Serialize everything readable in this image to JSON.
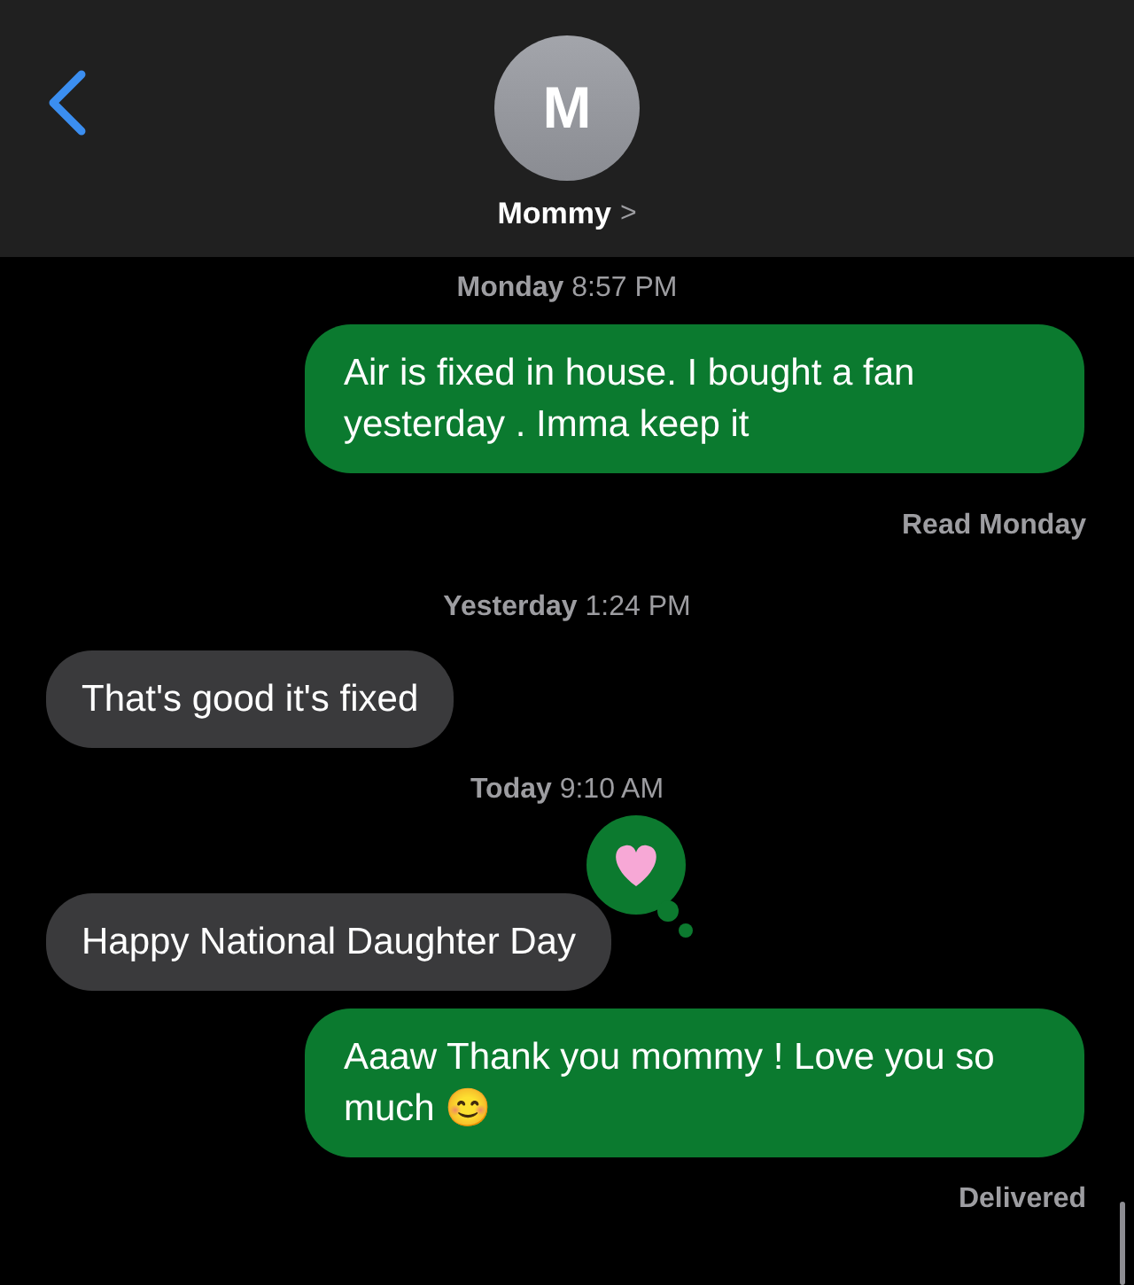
{
  "header": {
    "avatar_initial": "M",
    "contact_name": "Mommy",
    "chevron": ">"
  },
  "messages": [
    {
      "kind": "timestamp",
      "text": "**Monday** 8:57 PM"
    },
    {
      "kind": "sent",
      "text": "Air is fixed in house. I bought a fan yesterday . Imma keep it"
    },
    {
      "kind": "receipt",
      "text": "**Read** Monday"
    },
    {
      "kind": "timestamp",
      "text": "**Yesterday** 1:24 PM"
    },
    {
      "kind": "received",
      "text": "That's good it's fixed"
    },
    {
      "kind": "timestamp",
      "text": "**Today** 9:10 AM"
    },
    {
      "kind": "received",
      "text": "Happy National Daughter Day",
      "reaction": {
        "kind": "heart"
      }
    },
    {
      "kind": "sent",
      "text": "Aaaw Thank you mommy ! Love you so much 😊"
    },
    {
      "kind": "receipt",
      "text": "Delivered"
    }
  ]
}
